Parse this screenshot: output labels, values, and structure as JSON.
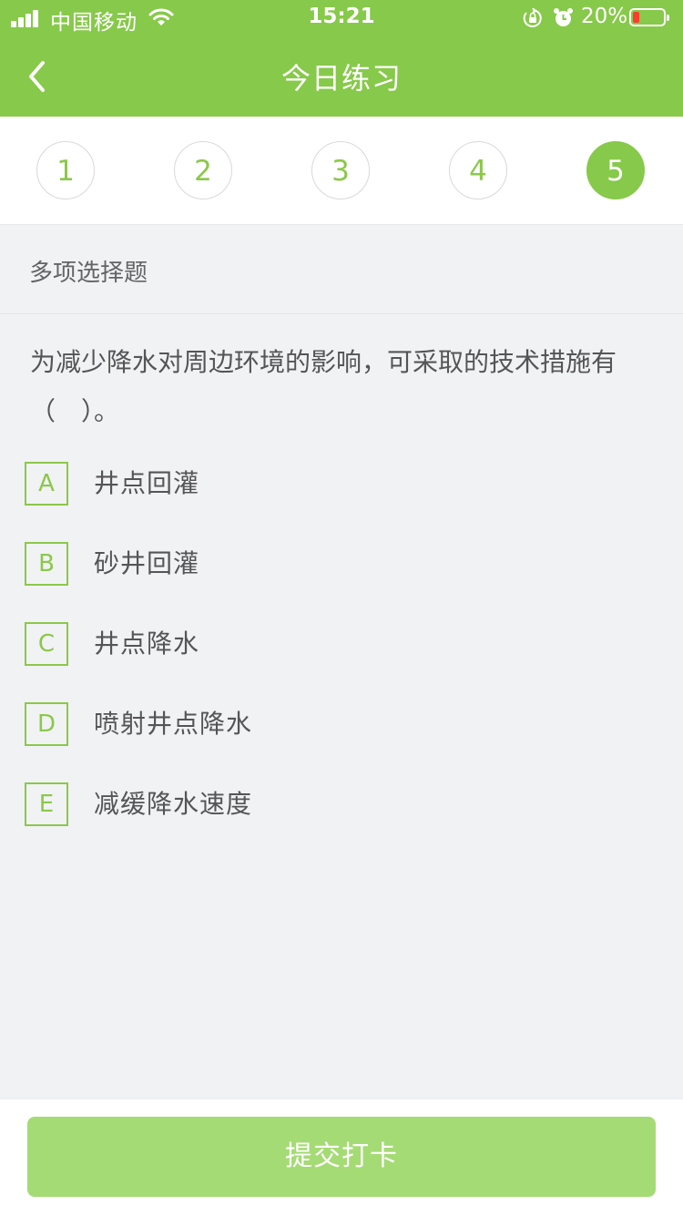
{
  "status_bar": {
    "carrier": "中国移动",
    "time": "15:21",
    "battery_text": "20%",
    "icons": [
      "signal-icon",
      "wifi-icon",
      "orientation-lock-icon",
      "alarm-clock-icon",
      "battery-icon"
    ]
  },
  "header": {
    "title": "今日练习",
    "back_icon": "chevron-left-icon"
  },
  "steps": {
    "items": [
      "1",
      "2",
      "3",
      "4",
      "5"
    ],
    "active_index": 4
  },
  "question": {
    "type": "多项选择题",
    "text": "为减少降水对周边环境的影响，可采取的技术措施有（　）。",
    "options": [
      {
        "letter": "A",
        "text": "井点回灌"
      },
      {
        "letter": "B",
        "text": "砂井回灌"
      },
      {
        "letter": "C",
        "text": "井点降水"
      },
      {
        "letter": "D",
        "text": "喷射井点降水"
      },
      {
        "letter": "E",
        "text": "减缓降水速度"
      }
    ]
  },
  "footer": {
    "submit_label": "提交打卡"
  },
  "colors": {
    "brand_green": "#87c94a",
    "button_green": "#a5db74",
    "background": "#f1f2f4",
    "battery_low": "#ff3b30"
  }
}
